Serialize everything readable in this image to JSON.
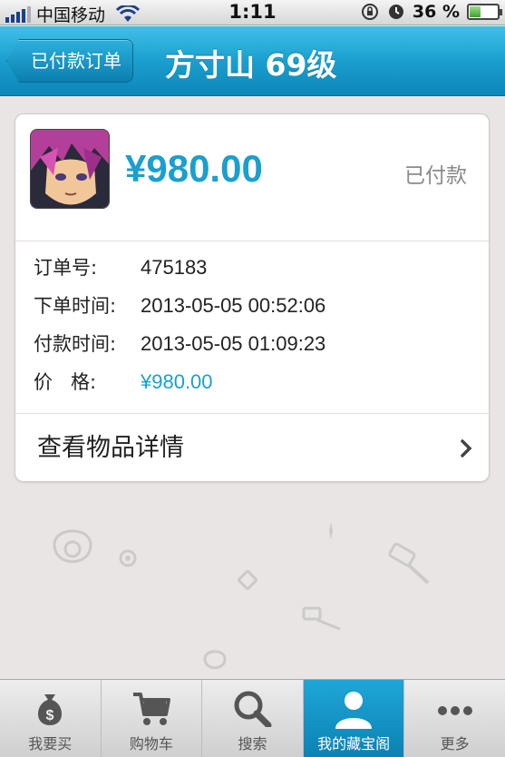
{
  "status_bar": {
    "carrier": "中国移动",
    "time": "1:11",
    "battery_percent": "36 %",
    "battery_level": 0.36
  },
  "nav": {
    "back_label": "已付款订单",
    "title": "方寸山 69级"
  },
  "order": {
    "price_big": "¥980.00",
    "status": "已付款",
    "rows": [
      {
        "label": "订单号:",
        "value": "475183"
      },
      {
        "label": "下单时间:",
        "value": "2013-05-05 00:52:06"
      },
      {
        "label": "付款时间:",
        "value": "2013-05-05 01:09:23"
      },
      {
        "label": "价   格:",
        "value": "¥980.00"
      }
    ],
    "view_detail": "查看物品详情"
  },
  "tabs": [
    {
      "label": "我要买",
      "icon": "money-bag-icon",
      "active": false
    },
    {
      "label": "购物车",
      "icon": "cart-icon",
      "active": false
    },
    {
      "label": "搜索",
      "icon": "search-icon",
      "active": false
    },
    {
      "label": "我的藏宝阁",
      "icon": "user-icon",
      "active": true
    },
    {
      "label": "更多",
      "icon": "more-dots-icon",
      "active": false
    }
  ],
  "colors": {
    "accent": "#1a9fcf",
    "background": "#e9e5e4"
  }
}
